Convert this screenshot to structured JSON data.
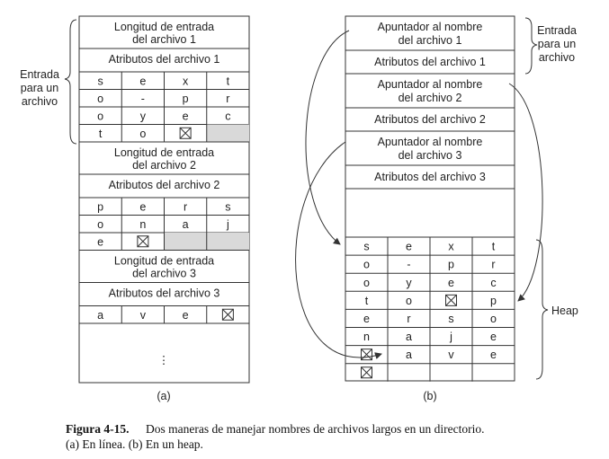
{
  "panel_a": {
    "label": "(a)",
    "side_label": [
      "Entrada",
      "para un",
      "archivo"
    ],
    "entries": [
      {
        "length_label": [
          "Longitud de entrada",
          "del archivo 1"
        ],
        "attr_label": "Atributos del archivo 1",
        "rows": [
          [
            "s",
            "e",
            "x",
            "t"
          ],
          [
            "o",
            "-",
            "p",
            "r"
          ],
          [
            "o",
            "y",
            "e",
            "c"
          ],
          [
            "t",
            "o",
            "⊠",
            ""
          ]
        ]
      },
      {
        "length_label": [
          "Longitud de entrada",
          "del archivo 2"
        ],
        "attr_label": "Atributos del archivo 2",
        "rows": [
          [
            "p",
            "e",
            "r",
            "s"
          ],
          [
            "o",
            "n",
            "a",
            "j"
          ],
          [
            "e",
            "⊠",
            "",
            ""
          ]
        ]
      },
      {
        "length_label": [
          "Longitud de entrada",
          "del archivo 3"
        ],
        "attr_label": "Atributos del archivo 3",
        "rows": [
          [
            "a",
            "v",
            "e",
            "⊠"
          ]
        ]
      }
    ],
    "ellipsis": "⋮"
  },
  "panel_b": {
    "label": "(b)",
    "side_label": [
      "Entrada",
      "para un",
      "archivo"
    ],
    "heap_label": "Heap",
    "entries": [
      {
        "pointer_label": [
          "Apuntador al nombre",
          "del archivo 1"
        ],
        "attr_label": "Atributos del archivo 1"
      },
      {
        "pointer_label": [
          "Apuntador al nombre",
          "del archivo 2"
        ],
        "attr_label": "Atributos del archivo 2"
      },
      {
        "pointer_label": [
          "Apuntador al nombre",
          "del archivo 3"
        ],
        "attr_label": "Atributos del archivo 3"
      }
    ],
    "heap_rows": [
      [
        "s",
        "e",
        "x",
        "t"
      ],
      [
        "o",
        "-",
        "p",
        "r"
      ],
      [
        "o",
        "y",
        "e",
        "c"
      ],
      [
        "t",
        "o",
        "⊠",
        "p"
      ],
      [
        "e",
        "r",
        "s",
        "o"
      ],
      [
        "n",
        "a",
        "j",
        "e"
      ],
      [
        "⊠",
        "a",
        "v",
        "e"
      ],
      [
        "⊠",
        "",
        "",
        ""
      ]
    ]
  },
  "caption": {
    "bold": "Figura 4-15.",
    "line1": "Dos maneras de manejar nombres de archivos largos en un directorio.",
    "line2": "(a) En línea.  (b) En un heap."
  },
  "colors": {
    "padding_fill": "#d9d9d9",
    "line": "#333333"
  }
}
